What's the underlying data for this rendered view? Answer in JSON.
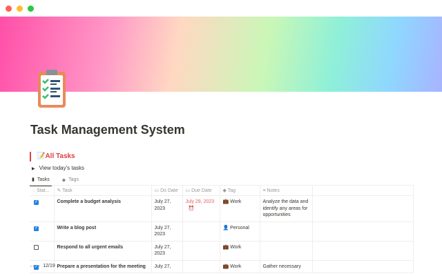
{
  "window": {
    "controls": [
      "close",
      "minimize",
      "maximize"
    ],
    "colors": [
      "#ff5f57",
      "#febc2e",
      "#28c840"
    ]
  },
  "page": {
    "icon": "clipboard-checklist-icon",
    "title": "Task Management System"
  },
  "callout": {
    "emoji": "📝",
    "text": "All Tasks"
  },
  "toggle": {
    "label": "View today's tasks"
  },
  "tabs": [
    {
      "label": "Tasks",
      "icon": "document-icon",
      "active": true
    },
    {
      "label": "Tags",
      "icon": "tag-icon",
      "active": false
    }
  ],
  "table": {
    "columns": [
      {
        "label": "Stat...",
        "icon": "status-icon"
      },
      {
        "label": "Task",
        "icon": "edit-icon"
      },
      {
        "label": "Do Date",
        "icon": "calendar-icon"
      },
      {
        "label": "Due Date",
        "icon": "calendar-icon"
      },
      {
        "label": "Tag",
        "icon": "tag-icon"
      },
      {
        "label": "Notes",
        "icon": "notes-icon"
      }
    ],
    "rows": [
      {
        "done": true,
        "task": "Complete a budget analysis",
        "do_date": "July 27, 2023",
        "due_date": "July 29, 2023",
        "overdue_alarm": true,
        "tag": "Work",
        "tag_emoji": "💼",
        "notes": "Analyze the data and identify any areas for opportunities"
      },
      {
        "done": true,
        "task": "Write a blog post",
        "do_date": "July 27, 2023",
        "due_date": "",
        "tag": "Personal",
        "tag_emoji": "👤",
        "notes": ""
      },
      {
        "done": false,
        "task": "Respond to all urgent emails",
        "do_date": "July 27, 2023",
        "due_date": "",
        "tag": "Work",
        "tag_emoji": "💼",
        "notes": ""
      },
      {
        "done": true,
        "task": "Prepare a presentation for the meeting",
        "do_date": "July 27,",
        "due_date": "",
        "tag": "Work",
        "tag_emoji": "💼",
        "notes": "Gather necessary"
      }
    ]
  },
  "footer": {
    "label": "LETE",
    "count": "12/19"
  },
  "colors": {
    "accent": "#e03e3e",
    "checkbox": "#2383e2",
    "overdue": "#eb5757"
  }
}
